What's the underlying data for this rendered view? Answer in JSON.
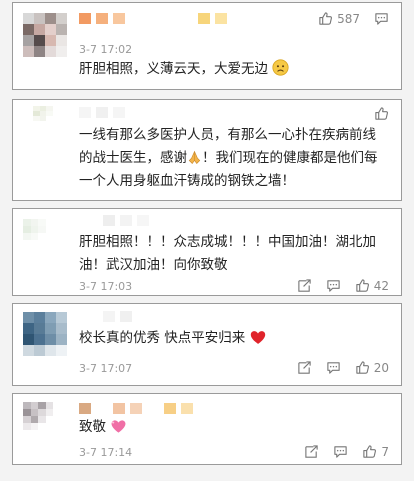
{
  "comments": [
    {
      "timestamp": "3-7 17:02",
      "text": "肝胆相照，义薄云天，大爱无边",
      "emoji": "worried-face-emoji",
      "likes": "587",
      "icons": [
        "thumbs-up-icon",
        "comment-icon"
      ]
    },
    {
      "timestamp": "",
      "text": "一线有那么多医护人员，有那么一心扑在疾病前线的战士医生，感谢",
      "text_tail": "！我们现在的健康都是他们每一个人用身躯血汗铸成的钢铁之墙！",
      "emoji": "praying-hands-emoji",
      "likes": "",
      "icons": [
        "thumbs-up-icon"
      ]
    },
    {
      "timestamp": "3-7 17:03",
      "text": "肝胆相照！！！众志成城！！！中国加油！湖北加油！武汉加油！向你致敬",
      "likes": "42",
      "icons": [
        "share-icon",
        "comment-icon",
        "thumbs-up-icon"
      ]
    },
    {
      "timestamp": "3-7 17:07",
      "text": "校长真的优秀 快点平安归来",
      "emoji": "red-heart-emoji",
      "likes": "20",
      "icons": [
        "share-icon",
        "comment-icon",
        "thumbs-up-icon"
      ]
    },
    {
      "timestamp": "3-7 17:14",
      "text": "致敬",
      "emoji": "sparkling-heart-emoji",
      "likes": "7",
      "icons": [
        "share-icon",
        "comment-icon",
        "thumbs-up-icon"
      ]
    }
  ],
  "colors": {
    "text": "#222222",
    "meta": "#999999",
    "border": "#9a9a9a",
    "heart_red": "#e0242b",
    "heart_pink": "#f06fa6",
    "emoji_yellow": "#f6c945"
  }
}
